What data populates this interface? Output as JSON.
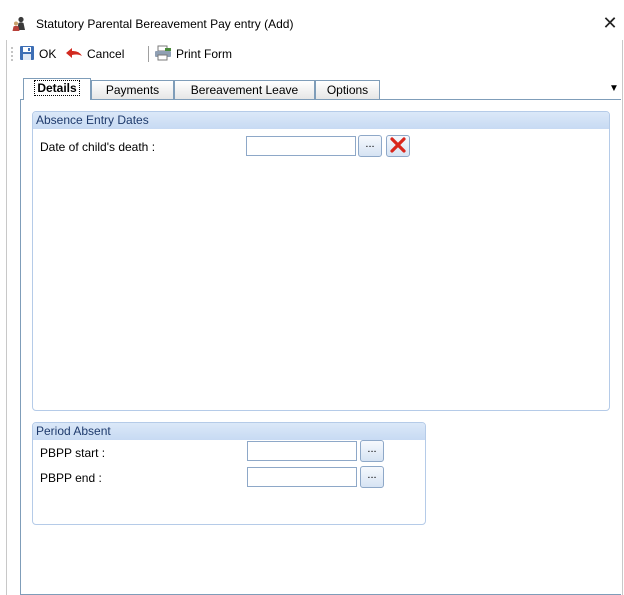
{
  "window": {
    "title": "Statutory Parental Bereavement Pay entry (Add)"
  },
  "toolbar": {
    "ok_label": "OK",
    "cancel_label": "Cancel",
    "print_label": "Print Form"
  },
  "tabs": [
    {
      "label": "Details",
      "active": true
    },
    {
      "label": "Payments",
      "active": false
    },
    {
      "label": "Bereavement Leave",
      "active": false
    },
    {
      "label": "Options",
      "active": false
    }
  ],
  "absence_entry_dates": {
    "title": "Absence Entry Dates",
    "date_of_death_label": "Date of child's death :",
    "date_of_death_value": "",
    "browse_label": "..."
  },
  "period_absent": {
    "title": "Period Absent",
    "start_label": "PBPP start :",
    "start_value": "",
    "end_label": "PBPP end :",
    "end_value": "",
    "browse_label": "..."
  },
  "icons": {
    "app": "people-icon",
    "ok": "save-disk-icon",
    "cancel": "red-undo-arrow-icon",
    "print": "print-form-icon",
    "clear": "red-x-icon",
    "dropdown": "triangle-down-icon"
  },
  "colors": {
    "group_header": "#c7daf3",
    "accent_border": "#7f9db9",
    "clear_red": "#d9261c"
  }
}
